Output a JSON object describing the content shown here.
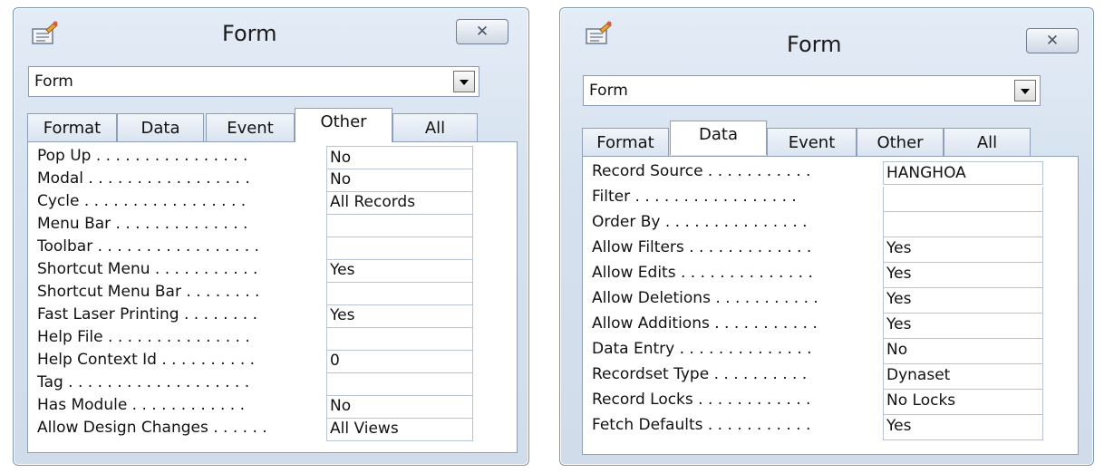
{
  "left": {
    "title": "Form",
    "icon": "properties-icon",
    "close_glyph": "✕",
    "selector_value": "Form",
    "tabs": [
      "Format",
      "Data",
      "Event",
      "Other",
      "All"
    ],
    "active_tab": "Other",
    "properties": [
      {
        "label": "Pop Up . . . . . . . . . . . . . . . .",
        "value": "No"
      },
      {
        "label": "Modal . . . . . . . . . . . . . . . . .",
        "value": "No"
      },
      {
        "label": "Cycle . . . . . . . . . . . . . . . . .",
        "value": "All Records"
      },
      {
        "label": "Menu Bar . . . . . . . . . . . . . .",
        "value": ""
      },
      {
        "label": "Toolbar . . . . . . . . . . . . . . . . .",
        "value": ""
      },
      {
        "label": "Shortcut Menu . . . . . . . . . . .",
        "value": "Yes"
      },
      {
        "label": "Shortcut Menu Bar . . . . . . . .",
        "value": ""
      },
      {
        "label": "Fast Laser Printing . . . . . . . .",
        "value": "Yes"
      },
      {
        "label": "Help File . . . . . . . . . . . . . . .",
        "value": ""
      },
      {
        "label": "Help Context Id . . . . . . . . . .",
        "value": "0"
      },
      {
        "label": "Tag . . . . . . . . . . . . . . . . . . .",
        "value": ""
      },
      {
        "label": "Has Module . . . . . . . . . . . .",
        "value": "No"
      },
      {
        "label": "Allow Design Changes . . . . . .",
        "value": "All Views"
      }
    ]
  },
  "right": {
    "title": "Form",
    "icon": "properties-icon",
    "close_glyph": "✕",
    "selector_value": "Form",
    "tabs": [
      "Format",
      "Data",
      "Event",
      "Other",
      "All"
    ],
    "active_tab": "Data",
    "properties": [
      {
        "label": "Record Source . . . . . . . . . . .",
        "value": "HANGHOA"
      },
      {
        "label": "Filter . . . . . . . . . . . . . . . . .",
        "value": ""
      },
      {
        "label": "Order By . . . . . . . . . . . . . . .",
        "value": ""
      },
      {
        "label": "Allow Filters . . . . . . . . . . . . .",
        "value": "Yes"
      },
      {
        "label": "Allow Edits . . . . . . . . . . . . . .",
        "value": "Yes"
      },
      {
        "label": "Allow Deletions . . . . . . . . . . .",
        "value": "Yes"
      },
      {
        "label": "Allow Additions . . . . . . . . . . .",
        "value": "Yes"
      },
      {
        "label": "Data Entry . . . . . . . . . . . . . .",
        "value": "No"
      },
      {
        "label": "Recordset Type . . . . . . . . . .",
        "value": "Dynaset"
      },
      {
        "label": "Record Locks . . . . . . . . . . . .",
        "value": "No Locks"
      },
      {
        "label": "Fetch Defaults . . . . . . . . . . .",
        "value": "Yes"
      }
    ]
  }
}
